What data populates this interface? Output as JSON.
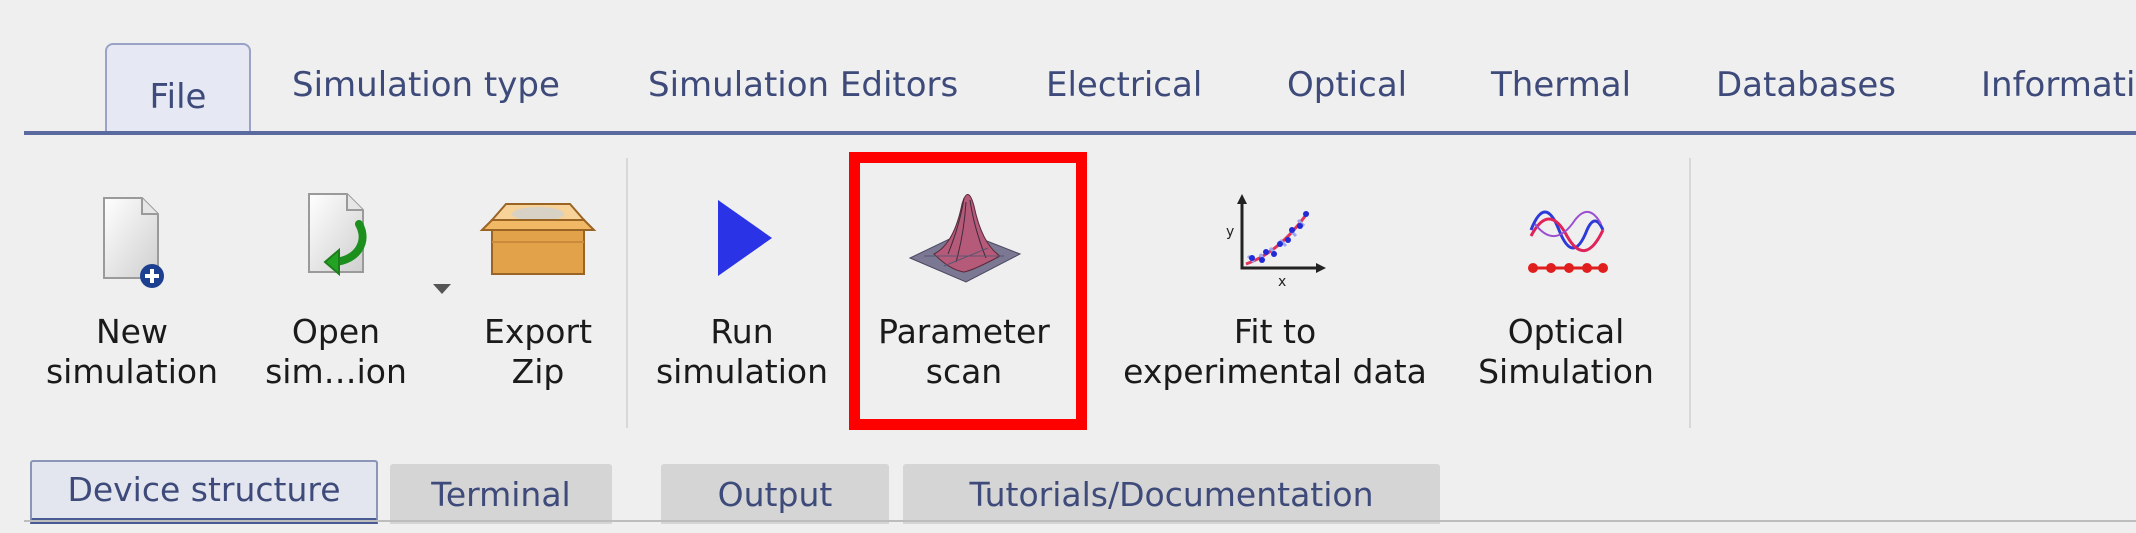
{
  "top_tabs": [
    {
      "label": "File",
      "active": true
    },
    {
      "label": "Simulation type"
    },
    {
      "label": "Simulation Editors"
    },
    {
      "label": "Electrical"
    },
    {
      "label": "Optical"
    },
    {
      "label": "Thermal"
    },
    {
      "label": "Databases"
    },
    {
      "label": "Informati"
    }
  ],
  "ribbon": {
    "new_simulation": [
      "New",
      "simulation"
    ],
    "open_simulation": [
      "Open",
      "sim…ion"
    ],
    "export_zip": [
      "Export",
      "Zip"
    ],
    "run_simulation": [
      "Run",
      "simulation"
    ],
    "parameter_scan": [
      "Parameter",
      "scan"
    ],
    "fit_experimental": [
      "Fit to",
      "experimental data"
    ],
    "optical_simulation": [
      "Optical",
      "Simulation"
    ]
  },
  "icons": {
    "new_simulation": "new-document-icon",
    "open_simulation": "open-document-icon",
    "export_zip": "package-box-icon",
    "run_simulation": "play-triangle-icon",
    "parameter_scan": "surface-plot-icon",
    "fit_experimental": "scatter-fit-icon",
    "optical_simulation": "optical-waves-icon"
  },
  "colors": {
    "highlight": "#ff0000",
    "tab_text": "#3d4a7a",
    "run_blue": "#2a33e6"
  },
  "bottom_tabs": [
    {
      "label": "Device structure",
      "active": true
    },
    {
      "label": "Terminal"
    },
    {
      "label": "Output"
    },
    {
      "label": "Tutorials/Documentation"
    }
  ]
}
